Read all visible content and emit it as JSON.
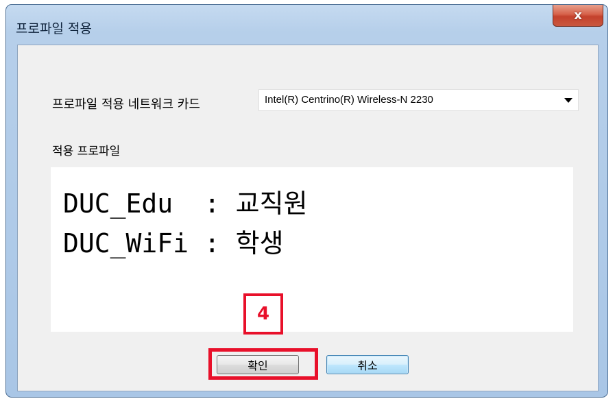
{
  "window": {
    "title": "프로파일 적용",
    "close_glyph": "x"
  },
  "nic": {
    "label": "프로파일 적용 네트워크 카드",
    "selected": "Intel(R) Centrino(R) Wireless-N 2230"
  },
  "profiles": {
    "label": "적용 프로파일",
    "lines": [
      "DUC_Edu  : 교직원",
      "DUC_WiFi : 학생"
    ]
  },
  "annotation": {
    "step_number": "4",
    "highlight_color": "#e8102a"
  },
  "buttons": {
    "ok_label": "확인",
    "cancel_label": "취소"
  }
}
